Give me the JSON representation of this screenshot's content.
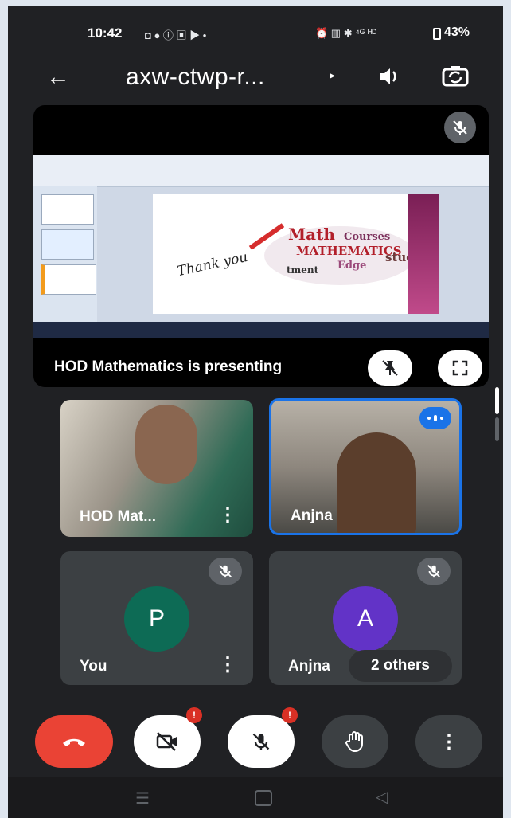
{
  "status_bar": {
    "time": "10:42",
    "notif_icons": "◘ ● ⓘ ▣ ▶ •",
    "sys_icons": "⏰ ▥ ✱ ⁴ᴳ ᴴᴰ",
    "battery": "43%"
  },
  "topbar": {
    "meeting_code": "axw-ctwp-r...",
    "caret": "▸"
  },
  "presentation": {
    "caption": "HOD Mathematics is presenting",
    "slide": {
      "handwriting": "Thank you",
      "words": [
        "Math",
        "MATHEMATICS",
        "Courses",
        "study",
        "Edge",
        "tment"
      ]
    }
  },
  "participants": [
    {
      "name": "HOD Mat..."
    },
    {
      "name": "Anjna"
    }
  ],
  "avatar_tiles": [
    {
      "initial": "P",
      "name": "You",
      "color": "#0d6b55"
    },
    {
      "initial": "A",
      "name": "Anjna",
      "others": "2 others",
      "color": "#6233c7"
    }
  ],
  "controls": {
    "end_call": "end-call",
    "camera_alert": "!",
    "mic_alert": "!"
  },
  "colors": {
    "end_call": "#ea4335",
    "background": "#202124",
    "tile": "#3c4043",
    "active_border": "#1a73e8"
  }
}
